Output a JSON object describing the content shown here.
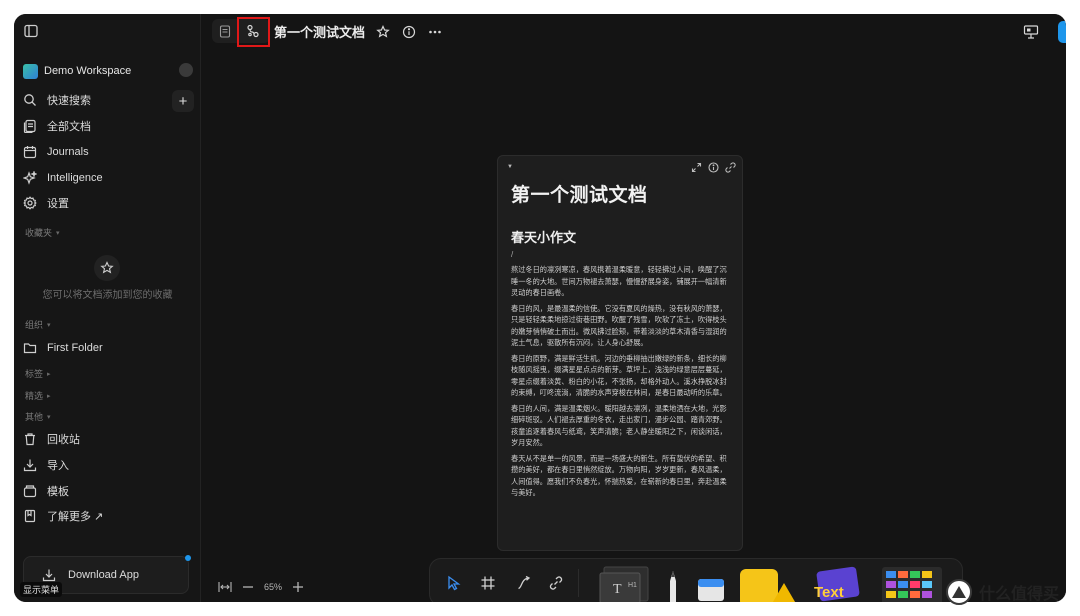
{
  "sidebar": {
    "workspace_name": "Demo Workspace",
    "nav": [
      {
        "label": "快速搜索",
        "icon": "search-icon"
      },
      {
        "label": "全部文档",
        "icon": "all-docs-icon"
      },
      {
        "label": "Journals",
        "icon": "journal-icon"
      },
      {
        "label": "Intelligence",
        "icon": "sparkle-icon"
      },
      {
        "label": "设置",
        "icon": "gear-icon"
      }
    ],
    "favorites_label": "收藏夹",
    "favorites_empty_text": "您可以将文档添加到您的收藏",
    "organize_label": "组织",
    "folder_label": "First Folder",
    "tags_label": "标签",
    "featured_label": "精选",
    "others_label": "其他",
    "others_items": [
      {
        "label": "回收站",
        "icon": "trash-icon"
      },
      {
        "label": "导入",
        "icon": "import-icon"
      },
      {
        "label": "模板",
        "icon": "template-icon"
      },
      {
        "label": "了解更多 ↗",
        "icon": "book-icon"
      }
    ],
    "download_label": "Download App",
    "show_menu_label": "显示菜单"
  },
  "topbar": {
    "doc_title": "第一个测试文档"
  },
  "note": {
    "title": "第一个测试文档",
    "heading": "春天小作文",
    "slash": "/",
    "paragraphs": [
      "熬过冬日的凛冽寒凉，春风携着温柔暖意，轻轻拂过人间，唤醒了沉睡一冬的大地。世间万物褪去萧瑟，慢慢舒展身姿，铺展开一幅清新灵动的春日画卷。",
      "春日的风，是最温柔的信使。它没有夏风的燥热，没有秋风的萧瑟，只是轻轻柔柔地掠过街巷田野。吹醒了残雪，吹软了冻土，吹得枝头的嫩芽悄悄破土而出。微风拂过脸颊，带着淡淡的草木清香与湿润的泥土气息，驱散所有沉闷，让人身心舒展。",
      "春日的原野，满是鲜活生机。河边的垂柳抽出嫩绿的新条，细长的柳枝随风摇曳，缀满星星点点的新芽。草坪上，浅浅的绿意层层蔓延，零星点缀着淡黄、粉白的小花，不张扬，却格外动人。溪水挣脱冰封的束缚，叮咚流淌，清脆的水声穿梭在林间，是春日最动听的乐章。",
      "春日的人间，满是温柔烟火。暖阳越去凛冽，温柔地洒在大地，光影细碎斑驳。人们褪去厚重的冬衣，走出家门，漫步公园、踏青郊野。孩童追逐着春风与纸鸢，笑声清脆；老人静坐暖阳之下，闲谈闲话，岁月安然。",
      "春天从不是单一的风景，而是一场盛大的新生。所有蛰伏的希望、积攒的美好，都在春日里悄然绽放。万物向阳，岁岁更新，春风温柔，人间值得。愿我们不负春光，怀揣热爱，在崭新的春日里，奔赴温柔与美好。"
    ]
  },
  "zoom": {
    "value": "65%"
  },
  "watermark": {
    "text": "什么值得买"
  },
  "colors": {
    "accent": "#1e96eb",
    "highlight": "#e01818",
    "background": "#141414",
    "note_bg": "#1e1e1e"
  }
}
